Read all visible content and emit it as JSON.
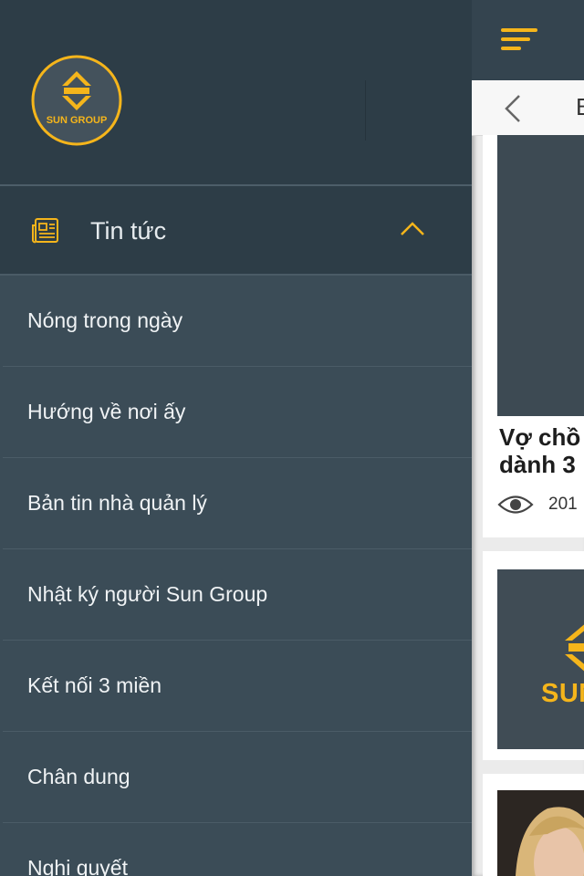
{
  "brand": {
    "logo_text": "SUN GROUP",
    "accent_color": "#f5b51b"
  },
  "drawer": {
    "section": {
      "label": "Tin tức",
      "icon": "newspaper-icon",
      "expanded": true
    },
    "items": [
      {
        "label": "Nóng trong ngày"
      },
      {
        "label": "Hướng về nơi ấy"
      },
      {
        "label": "Bản tin nhà quản lý"
      },
      {
        "label": "Nhật ký người Sun Group"
      },
      {
        "label": "Kết nối 3 miền"
      },
      {
        "label": "Chân dung"
      },
      {
        "label": "Nghị quyết"
      }
    ]
  },
  "content": {
    "nav_title": "B",
    "article1": {
      "title_line1": "Vợ chồ",
      "title_line2": "dành 3",
      "views": "201"
    },
    "article2": {
      "brand_text": "SUN G"
    }
  }
}
